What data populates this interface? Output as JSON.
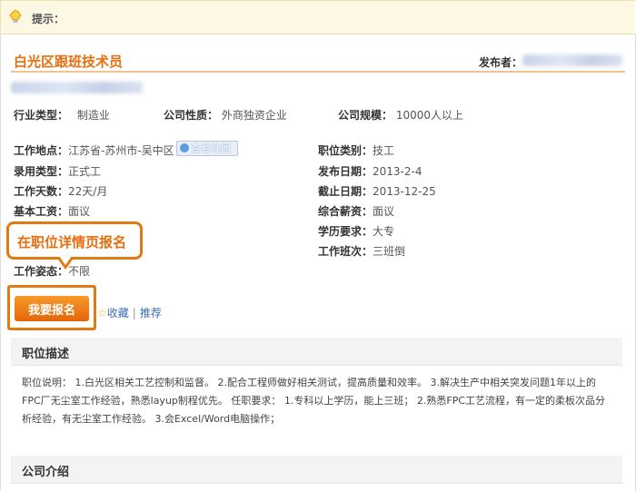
{
  "tip": {
    "label": "提示：",
    "icon": "lightbulb-icon"
  },
  "job": {
    "title": "白光区跟班技术员",
    "publisher_label": "发布者："
  },
  "summary": {
    "industry": {
      "label": "行业类型：",
      "value": "制造业"
    },
    "company_nature": {
      "label": "公司性质：",
      "value": "外商独资企业"
    },
    "company_size": {
      "label": "公司规模：",
      "value": "10000人以上"
    }
  },
  "details": {
    "location": {
      "label": "工作地点：",
      "value": "江苏省-苏州市-吴中区"
    },
    "map_button": "查看地图",
    "employment_type": {
      "label": "录用类型：",
      "value": "正式工"
    },
    "work_days": {
      "label": "工作天数：",
      "value": "22天/月"
    },
    "base_salary": {
      "label": "基本工资：",
      "value": "面议"
    },
    "work_status": {
      "label": "工作姿态：",
      "value": "不限"
    },
    "category": {
      "label": "职位类别：",
      "value": "技工"
    },
    "publish_date": {
      "label": "发布日期：",
      "value": "2013-2-4"
    },
    "deadline": {
      "label": "截止日期：",
      "value": "2013-12-25"
    },
    "total_salary": {
      "label": "综合薪资：",
      "value": "面议"
    },
    "education": {
      "label": "学历要求：",
      "value": "大专"
    },
    "shift": {
      "label": "工作班次：",
      "value": "三班倒"
    }
  },
  "callout": {
    "text": "在职位详情页报名"
  },
  "actions": {
    "apply_button": "我要报名",
    "favorite": "收藏",
    "separator": "|",
    "recommend": "推荐"
  },
  "sections": {
    "description_title": "职位描述",
    "description_text": "职位说明：  1.白光区相关工艺控制和监督。  2.配合工程师做好相关测试，提高质量和效率。  3.解决生产中相关突发问题1年以上的FPC厂无尘室工作经验，熟悉layup制程优先。          任职要求：  1.专科以上学历，能上三班；  2.熟悉FPC工艺流程，有一定的柔板次品分析经验，有无尘室工作经验。  3.会Excel/Word电脑操作；",
    "company_title": "公司介绍"
  },
  "colors": {
    "accent": "#e86d0c",
    "link": "#3a6bb5",
    "tip_bg": "#fdf8e4"
  }
}
